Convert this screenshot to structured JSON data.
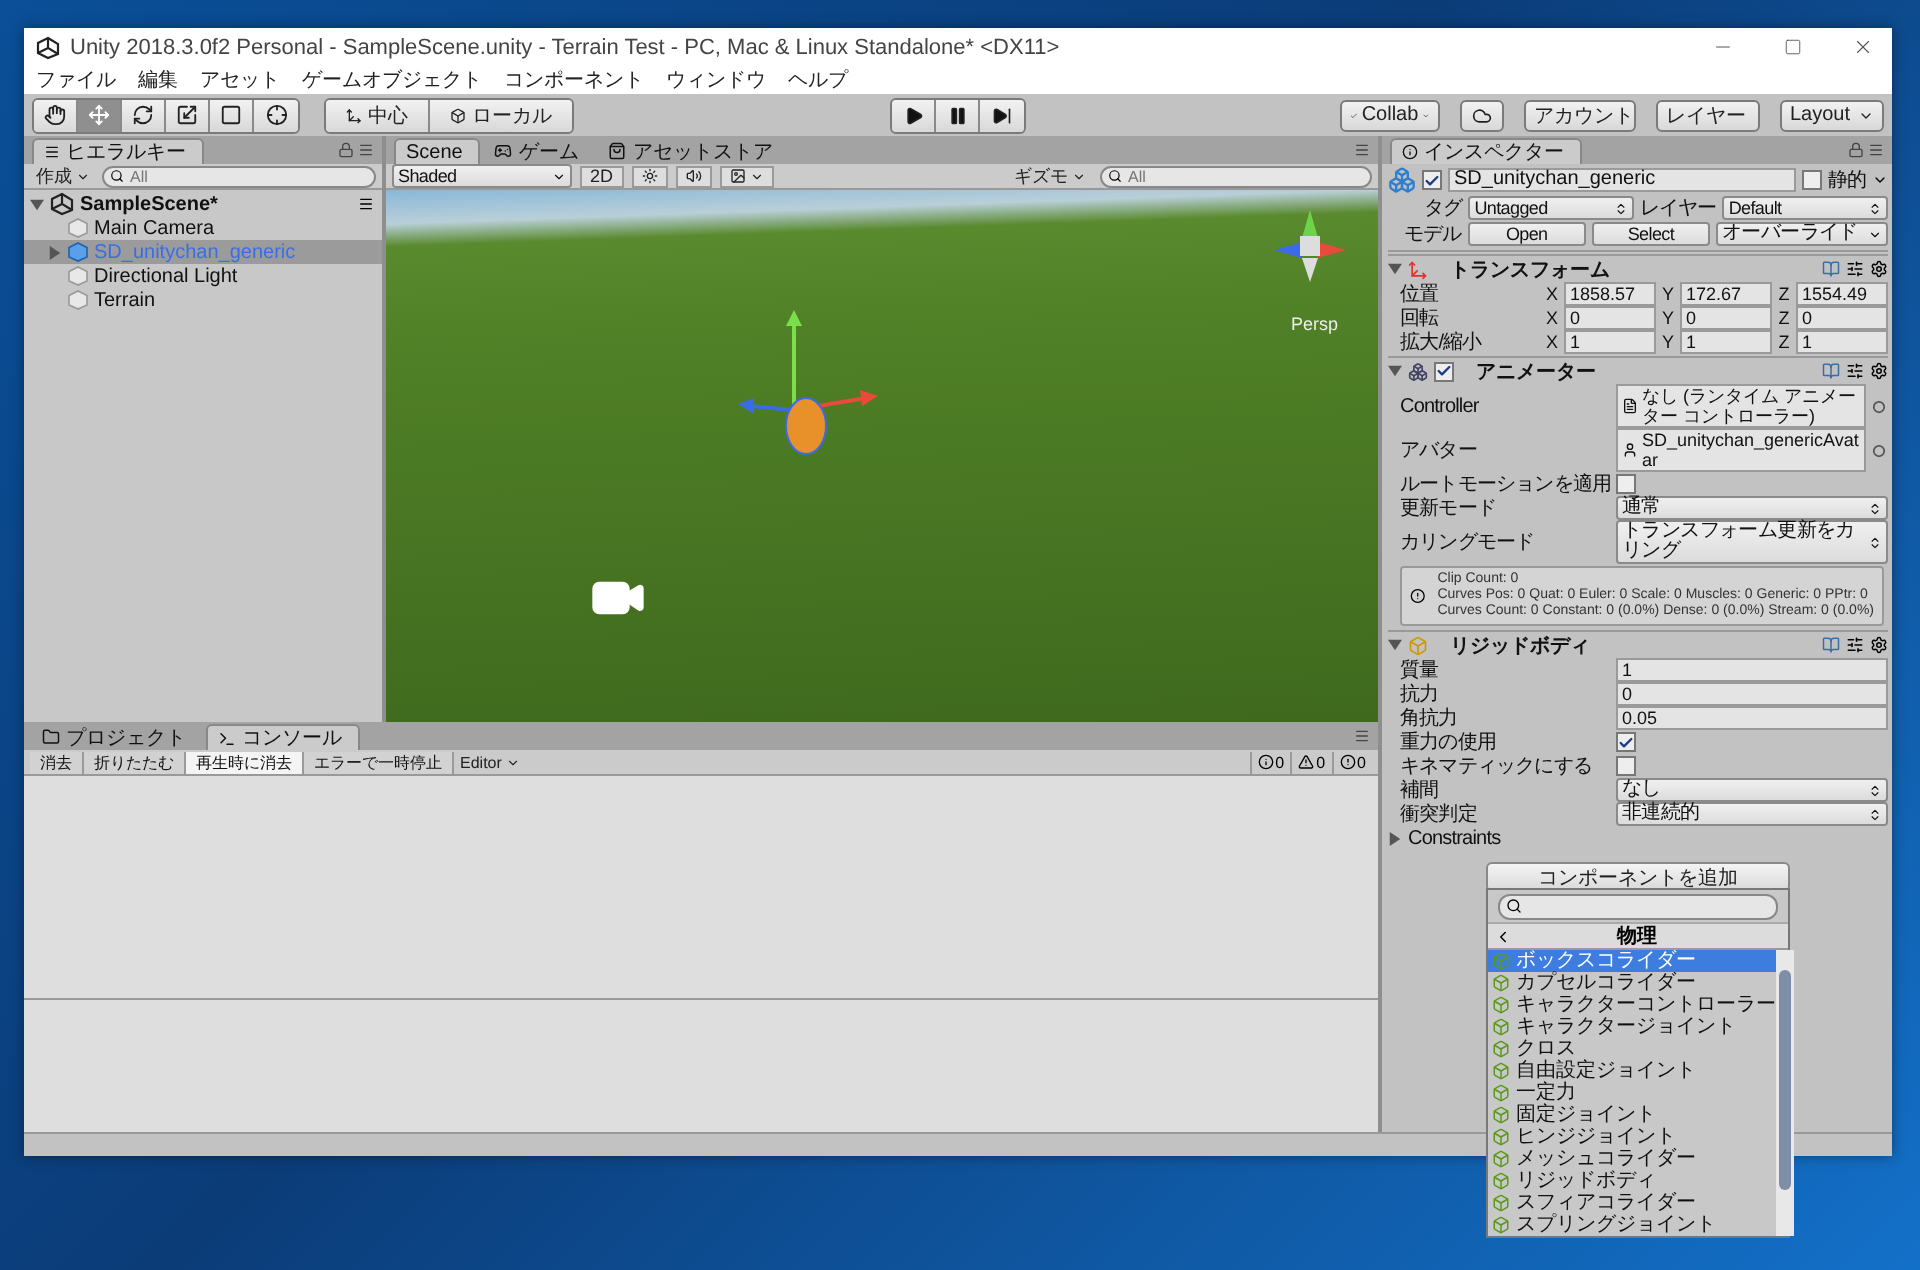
{
  "window": {
    "title": "Unity 2018.3.0f2 Personal - SampleScene.unity - Terrain Test - PC, Mac & Linux Standalone* <DX11>"
  },
  "menu": [
    "ファイル",
    "編集",
    "アセット",
    "ゲームオブジェクト",
    "コンポーネント",
    "ウィンドウ",
    "ヘルプ"
  ],
  "toolbar": {
    "tools": [
      {
        "kind": "hand",
        "selected": false
      },
      {
        "kind": "move",
        "selected": true
      },
      {
        "kind": "rotate",
        "selected": false
      },
      {
        "kind": "scale",
        "selected": false
      },
      {
        "kind": "rect",
        "selected": false
      },
      {
        "kind": "transform",
        "selected": false
      }
    ],
    "pivot": [
      "中心",
      "ローカル"
    ],
    "collab": "Collab",
    "account": "アカウント",
    "layers": "レイヤー",
    "layout": "Layout"
  },
  "hierarchy": {
    "tab": "ヒエラルキー",
    "create": "作成",
    "search_placeholder": "All",
    "scene": {
      "label": "SampleScene*",
      "expanded": true
    },
    "items": [
      {
        "label": "Main Camera",
        "kind": "object",
        "expander": false,
        "selected": false
      },
      {
        "label": "SD_unitychan_generic",
        "kind": "prefab",
        "expander": true,
        "selected": true
      },
      {
        "label": "Directional Light",
        "kind": "object",
        "expander": false,
        "selected": false
      },
      {
        "label": "Terrain",
        "kind": "object",
        "expander": false,
        "selected": false
      }
    ]
  },
  "scene": {
    "tabs": [
      {
        "label": "Scene",
        "kind": "scene",
        "selected": true
      },
      {
        "label": "ゲーム",
        "kind": "game",
        "selected": false
      },
      {
        "label": "アセットストア",
        "kind": "store",
        "selected": false
      }
    ],
    "shading": "Shaded",
    "mode_2d": {
      "label": "2D",
      "on": false
    },
    "lighting_on": false,
    "audio_on": false,
    "gizmos": "ギズモ",
    "search_placeholder": "All",
    "view_label": "Persp"
  },
  "console": {
    "tabs": [
      {
        "label": "プロジェクト",
        "kind": "project",
        "selected": false
      },
      {
        "label": "コンソール",
        "kind": "console",
        "selected": true
      }
    ],
    "buttons": [
      {
        "label": "消去",
        "on": false
      },
      {
        "label": "折りたたむ",
        "on": false
      },
      {
        "label": "再生時に消去",
        "on": true
      },
      {
        "label": "エラーで一時停止",
        "on": false
      }
    ],
    "editor": "Editor",
    "counts": [
      {
        "kind": "info",
        "count": "0"
      },
      {
        "kind": "warning",
        "count": "0"
      },
      {
        "kind": "error",
        "count": "0"
      }
    ]
  },
  "inspector": {
    "tab": "インスペクター",
    "object": {
      "name": "SD_unitychan_generic",
      "active": true,
      "static_label": "静的",
      "static": false,
      "tag_label": "タグ",
      "tag": "Untagged",
      "layer_label": "レイヤー",
      "layer": "Default",
      "model_label": "モデル",
      "open": "Open",
      "select": "Select",
      "overrides": "オーバーライド"
    },
    "transform": {
      "title": "トランスフォーム",
      "expanded": true,
      "rows": [
        {
          "label": "位置",
          "values": [
            {
              "axis": "X",
              "value": "1858.57"
            },
            {
              "axis": "Y",
              "value": "172.67"
            },
            {
              "axis": "Z",
              "value": "1554.49"
            }
          ]
        },
        {
          "label": "回転",
          "values": [
            {
              "axis": "X",
              "value": "0"
            },
            {
              "axis": "Y",
              "value": "0"
            },
            {
              "axis": "Z",
              "value": "0"
            }
          ]
        },
        {
          "label": "拡大/縮小",
          "values": [
            {
              "axis": "X",
              "value": "1"
            },
            {
              "axis": "Y",
              "value": "1"
            },
            {
              "axis": "Z",
              "value": "1"
            }
          ]
        }
      ]
    },
    "animator": {
      "title": "アニメーター",
      "expanded": true,
      "enabled": true,
      "fields": [
        {
          "label": "Controller",
          "kind": "controller",
          "value": "なし (ランタイム アニメーター コントローラー)"
        },
        {
          "label": "アバター",
          "kind": "avatar",
          "value": "SD_unitychan_genericAvatar"
        },
        {
          "label": "ルートモーションを適用",
          "kind": "checkbox",
          "checked": false
        },
        {
          "label": "更新モード",
          "kind": "dropdown",
          "value": "通常"
        },
        {
          "label": "カリングモード",
          "kind": "dropdown",
          "value": "トランスフォーム更新をカリング"
        }
      ],
      "info": [
        "Clip Count: 0",
        "Curves Pos: 0 Quat: 0 Euler: 0 Scale: 0 Muscles: 0 Generic: 0 PPtr: 0",
        "Curves Count: 0 Constant: 0 (0.0%) Dense: 0 (0.0%) Stream: 0 (0.0%)"
      ]
    },
    "rigidbody": {
      "title": "リジッドボディ",
      "expanded": true,
      "fields": [
        {
          "label": "質量",
          "kind": "text",
          "value": "1"
        },
        {
          "label": "抗力",
          "kind": "text",
          "value": "0"
        },
        {
          "label": "角抗力",
          "kind": "text",
          "value": "0.05"
        },
        {
          "label": "重力の使用",
          "kind": "checkbox",
          "checked": true
        },
        {
          "label": "キネマティックにする",
          "kind": "checkbox",
          "checked": false
        },
        {
          "label": "補間",
          "kind": "dropdown",
          "value": "なし"
        },
        {
          "label": "衝突判定",
          "kind": "dropdown",
          "value": "非連続的"
        }
      ],
      "constraints": {
        "label": "Constraints",
        "expanded": false
      }
    },
    "add_component": {
      "button": "コンポーネントを追加",
      "category": "物理",
      "items": [
        {
          "label": "ボックスコライダー",
          "selected": true
        },
        {
          "label": "カプセルコライダー",
          "selected": false
        },
        {
          "label": "キャラクターコントローラー",
          "selected": false
        },
        {
          "label": "キャラクタージョイント",
          "selected": false
        },
        {
          "label": "クロス",
          "selected": false
        },
        {
          "label": "自由設定ジョイント",
          "selected": false
        },
        {
          "label": "一定力",
          "selected": false
        },
        {
          "label": "固定ジョイント",
          "selected": false
        },
        {
          "label": "ヒンジジョイント",
          "selected": false
        },
        {
          "label": "メッシュコライダー",
          "selected": false
        },
        {
          "label": "リジッドボディ",
          "selected": false
        },
        {
          "label": "スフィアコライダー",
          "selected": false
        },
        {
          "label": "スプリングジョイント",
          "selected": false
        }
      ]
    }
  }
}
